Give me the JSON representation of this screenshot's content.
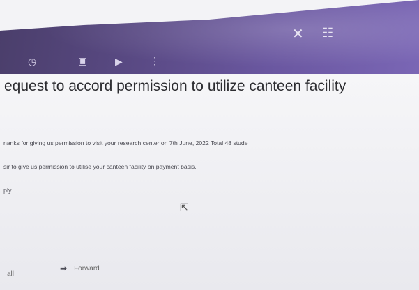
{
  "header": {
    "close_glyph": "✕",
    "tune_glyph": "☷"
  },
  "toolbar": {
    "icons": [
      "snooze-icon",
      "mail-icon",
      "label-icon",
      "more-vert-icon"
    ],
    "glyphs": [
      "◷",
      "▣",
      "▶",
      "⋮"
    ]
  },
  "email": {
    "subject": "equest to accord permission to utilize canteen facility",
    "body_lines": [
      "nanks for giving  us permission to visit your research center on 7th June, 2022  Total 48 stude",
      "sir to give us permission to utilise your canteen facility on payment basis."
    ],
    "reply_label": "ply"
  },
  "footer": {
    "reply_all_label": "all",
    "forward_label": "Forward",
    "forward_glyph": "➡"
  },
  "colors": {
    "header": "#5a4a85",
    "background": "#f3f3f6",
    "text": "#2c2c30"
  }
}
